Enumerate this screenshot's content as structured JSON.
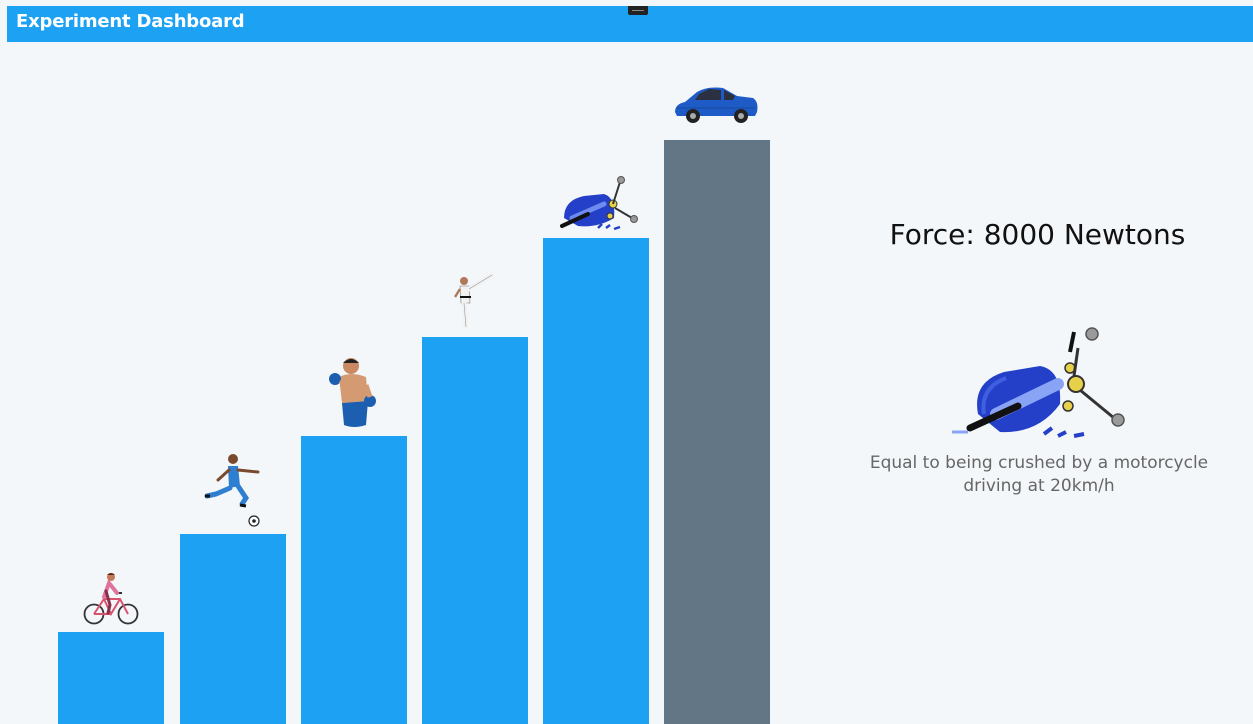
{
  "window": {
    "title": "Experiment Dashboard"
  },
  "colors": {
    "titlebar": "#1da1f2",
    "bar_active": "#1da1f2",
    "bar_inactive": "#637685",
    "background": "#f4f7fa"
  },
  "levels": [
    {
      "icon": "bicycle-rider-icon",
      "state": "active"
    },
    {
      "icon": "soccer-player-icon",
      "state": "active"
    },
    {
      "icon": "boxer-icon",
      "state": "active"
    },
    {
      "icon": "karate-kick-icon",
      "state": "active"
    },
    {
      "icon": "motorcycle-crash-icon",
      "state": "active"
    },
    {
      "icon": "car-icon",
      "state": "inactive"
    }
  ],
  "detail": {
    "force_label": "Force: 8000 Newtons",
    "icon": "motorcycle-crash-icon",
    "description": "Equal to being crushed by a motorcycle driving at 20km/h"
  }
}
